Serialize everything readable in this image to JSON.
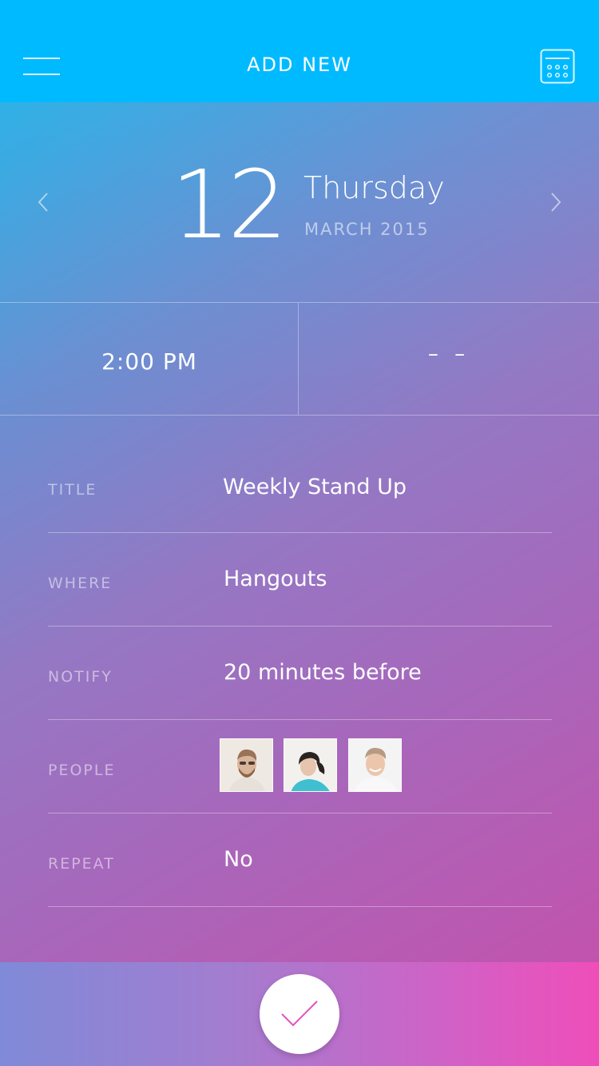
{
  "header": {
    "title": "ADD NEW",
    "menu_icon": "hamburger-menu-icon",
    "calendar_icon": "calendar-icon",
    "background": "#00baff"
  },
  "date": {
    "day": "12",
    "weekday": "Thursday",
    "month_year": "MARCH 2015",
    "prev_icon": "chevron-left-icon",
    "next_icon": "chevron-right-icon"
  },
  "time": {
    "start": "2:00 PM",
    "end": "– –"
  },
  "form": {
    "title": {
      "label": "TITLE",
      "value": "Weekly Stand Up"
    },
    "where": {
      "label": "WHERE",
      "value": "Hangouts"
    },
    "notify": {
      "label": "NOTIFY",
      "value": "20 minutes before"
    },
    "people": {
      "label": "PEOPLE",
      "avatars": [
        "person-1-avatar",
        "person-2-avatar",
        "person-3-avatar"
      ]
    },
    "repeat": {
      "label": "REPEAT",
      "value": "No"
    }
  },
  "footer": {
    "confirm_icon": "checkmark-icon",
    "accent": "#e44fbd"
  }
}
